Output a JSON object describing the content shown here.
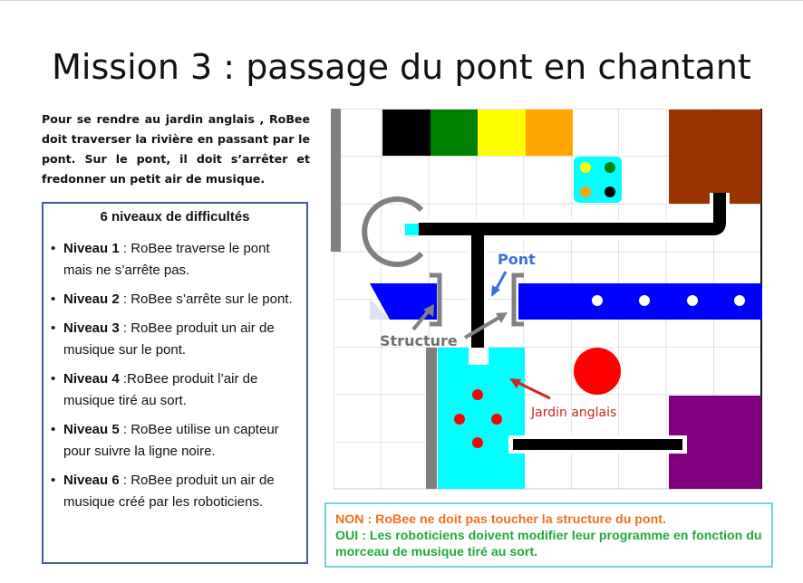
{
  "title": "Mission 3 : passage du pont en chantant",
  "intro": "Pour se rendre au jardin anglais , RoBee doit traverser la rivière en passant par le pont. Sur le pont, il doit s’arrêter et fredonner un petit air de musique.",
  "levels": {
    "heading": "6 niveaux de difficultés",
    "items": [
      {
        "name": "Niveau 1",
        "sep": " : ",
        "text": "RoBee traverse le pont mais ne s’arrête pas."
      },
      {
        "name": "Niveau 2",
        "sep": " : ",
        "text": "RoBee s’arrête sur le pont."
      },
      {
        "name": "Niveau 3",
        "sep": " : ",
        "text": "RoBee produit un air de musique sur le pont."
      },
      {
        "name": "Niveau 4",
        "sep": " :",
        "text": "RoBee produit l’air de musique tiré au sort."
      },
      {
        "name": "Niveau 5",
        "sep": " : ",
        "text": "RoBee utilise un capteur pour suivre la ligne noire."
      },
      {
        "name": "Niveau 6",
        "sep": " : ",
        "text": "RoBee produit un air de musique créé par les roboticiens."
      }
    ]
  },
  "map": {
    "labels": {
      "pont": "Pont",
      "structure": "Structure",
      "jardin": "Jardin anglais"
    },
    "colors": {
      "black": "#000000",
      "green": "#008000",
      "yellow": "#ffff00",
      "orange": "#ffa500",
      "brown": "#993300",
      "cyan": "#00ffff",
      "blue": "#0000ff",
      "red": "#ff0000",
      "purple": "#800080",
      "gray": "#808080"
    }
  },
  "note": {
    "non": "NON : RoBee ne doit pas toucher la structure du pont.",
    "oui": "OUI : Les roboticiens doivent modifier leur programme en fonction du morceau de musique tiré au sort."
  }
}
